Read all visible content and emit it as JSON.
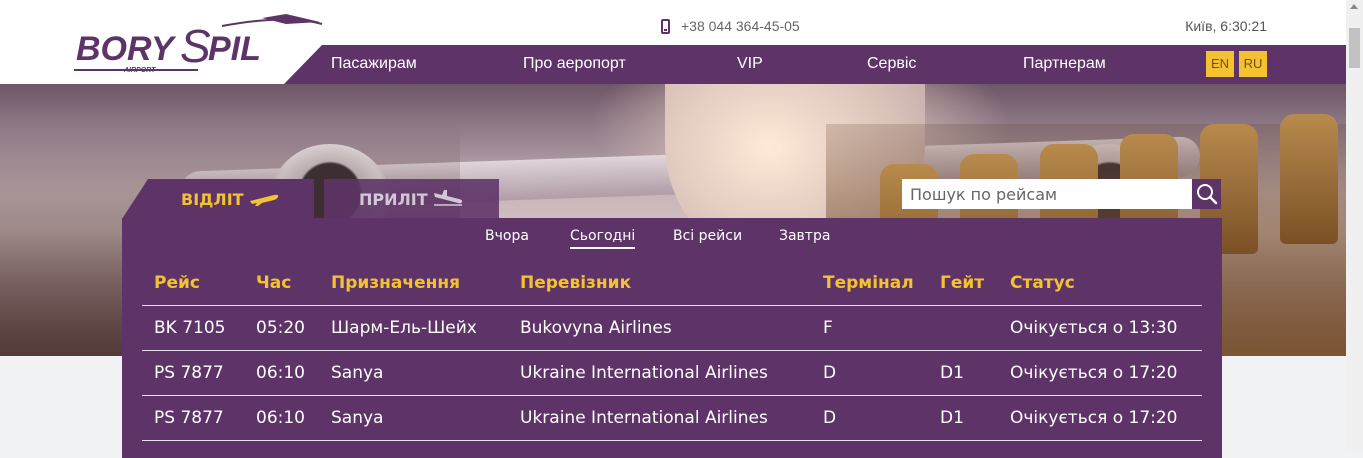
{
  "brand": {
    "logo_text": "BORYSPIL",
    "logo_sub": "AIRPORT",
    "accent": "#5e3468",
    "yellow": "#f2c230"
  },
  "header": {
    "phone": "+38 044 364-45-05",
    "clock": "Київ, 6:30:21"
  },
  "nav": {
    "items": [
      "Пасажирам",
      "Про аеропорт",
      "VIP",
      "Сервіс",
      "Партнерам"
    ],
    "langs": [
      "EN",
      "RU"
    ]
  },
  "search": {
    "placeholder": "Пошук по рейсам"
  },
  "tabs": {
    "departures": "ВІДЛІТ",
    "arrivals": "ПРИЛІТ"
  },
  "days": {
    "active": "Сьогодні",
    "items": [
      "Вчора",
      "Сьогодні",
      "Всі рейси",
      "Завтра"
    ]
  },
  "columns": [
    "Рейс",
    "Час",
    "Призначення",
    "Перевізник",
    "Термінал",
    "Гейт",
    "Статус"
  ],
  "flights": [
    {
      "flight": "BK 7105",
      "time": "05:20",
      "destination": "Шарм-Ель-Шейх",
      "carrier": "Bukovyna Airlines",
      "terminal": "F",
      "gate": "",
      "status": "Очікується о 13:30"
    },
    {
      "flight": "PS 7877",
      "time": "06:10",
      "destination": "Sanya",
      "carrier": "Ukraine International Airlines",
      "terminal": "D",
      "gate": "D1",
      "status": "Очікується о 17:20"
    },
    {
      "flight": "PS 7877",
      "time": "06:10",
      "destination": "Sanya",
      "carrier": "Ukraine International Airlines",
      "terminal": "D",
      "gate": "D1",
      "status": "Очікується о 17:20"
    }
  ]
}
